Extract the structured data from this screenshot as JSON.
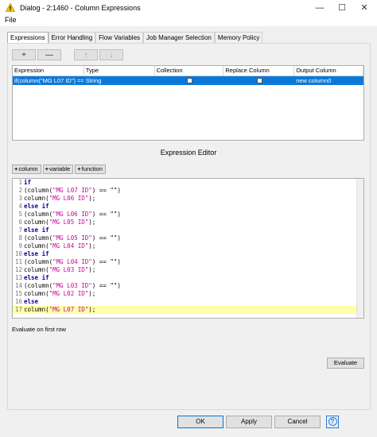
{
  "window": {
    "title": "Dialog - 2:1460 - Column Expressions",
    "minimize": "—",
    "maximize": "☐",
    "close": "✕"
  },
  "menu": {
    "file": "File"
  },
  "tabs": [
    {
      "label": "Expressions"
    },
    {
      "label": "Error Handling"
    },
    {
      "label": "Flow Variables"
    },
    {
      "label": "Job Manager Selection"
    },
    {
      "label": "Memory Policy"
    }
  ],
  "toolbar": {
    "add": "+",
    "remove": "—",
    "up": "↑",
    "down": "↓"
  },
  "table": {
    "headers": [
      "Expression",
      "Type",
      "Collection",
      "Replace Column",
      "Output Column"
    ],
    "row": {
      "expression": "if(column(\"MG L07 ID\") ==...",
      "type": "String",
      "output": "new column0"
    }
  },
  "editor": {
    "title": "Expression Editor",
    "insert_column": "column",
    "insert_variable": "variable",
    "insert_function": "function",
    "lines": [
      {
        "n": "1",
        "kw": "if",
        "fn": "",
        "str": "",
        "tail": ""
      },
      {
        "n": "2",
        "kw": "",
        "fn": "(column(",
        "str": "\"MG L07 ID\"",
        "tail": ") == \"\")"
      },
      {
        "n": "3",
        "kw": "",
        "fn": "column(",
        "str": "\"MG L06 ID\"",
        "tail": ");"
      },
      {
        "n": "4",
        "kw": "else if",
        "fn": "",
        "str": "",
        "tail": ""
      },
      {
        "n": "5",
        "kw": "",
        "fn": "(column(",
        "str": "\"MG L06 ID\"",
        "tail": ") == \"\")"
      },
      {
        "n": "6",
        "kw": "",
        "fn": "column(",
        "str": "\"MG L05 ID\"",
        "tail": ");"
      },
      {
        "n": "7",
        "kw": "else if",
        "fn": "",
        "str": "",
        "tail": ""
      },
      {
        "n": "8",
        "kw": "",
        "fn": "(column(",
        "str": "\"MG L05 ID\"",
        "tail": ") == \"\")"
      },
      {
        "n": "9",
        "kw": "",
        "fn": "column(",
        "str": "\"MG L04 ID\"",
        "tail": ");"
      },
      {
        "n": "10",
        "kw": "else if",
        "fn": "",
        "str": "",
        "tail": ""
      },
      {
        "n": "11",
        "kw": "",
        "fn": "(column(",
        "str": "\"MG L04 ID\"",
        "tail": ") == \"\")"
      },
      {
        "n": "12",
        "kw": "",
        "fn": "column(",
        "str": "\"MG L03 ID\"",
        "tail": ");"
      },
      {
        "n": "13",
        "kw": "else if",
        "fn": "",
        "str": "",
        "tail": ""
      },
      {
        "n": "14",
        "kw": "",
        "fn": "(column(",
        "str": "\"MG L03 ID\"",
        "tail": ") == \"\")"
      },
      {
        "n": "15",
        "kw": "",
        "fn": "column(",
        "str": "\"MG L02 ID\"",
        "tail": ");"
      },
      {
        "n": "16",
        "kw": "else",
        "fn": "",
        "str": "",
        "tail": ""
      },
      {
        "n": "17",
        "kw": "",
        "fn": "column(",
        "str": "\"MG L07 ID\"",
        "tail": ");"
      }
    ]
  },
  "options": {
    "evaluate_first_row": "Evaluate on first row"
  },
  "buttons": {
    "evaluate": "Evaluate",
    "ok": "OK",
    "apply": "Apply",
    "cancel": "Cancel",
    "help": "?"
  },
  "colors": {
    "selection": "#0c79d8",
    "keyword": "#0000a0",
    "string": "#d0009e",
    "current_line": "#ffffaa"
  }
}
